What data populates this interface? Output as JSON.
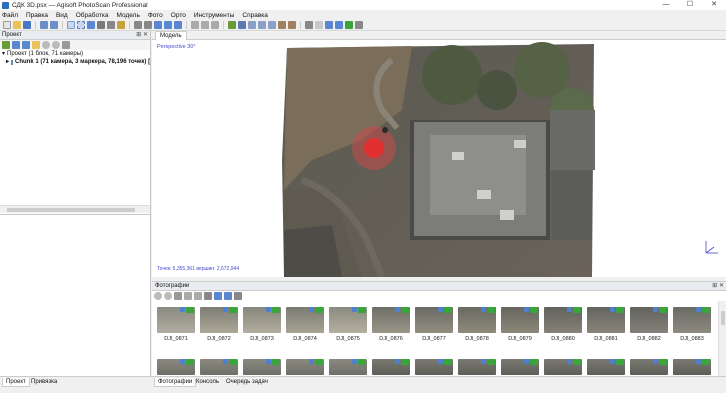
{
  "window": {
    "title": "СДК 3D.psx — Agisoft PhotoScan Professional",
    "controls": [
      "—",
      "☐",
      "✕"
    ]
  },
  "menu": [
    "Файл",
    "Правка",
    "Вид",
    "Обработка",
    "Модель",
    "Фото",
    "Орто",
    "Инструменты",
    "Справка"
  ],
  "project_panel": {
    "title": "Проект",
    "tree": {
      "root": "Проект (1 блок, 71 камеры)",
      "chunk": "Chunk 1 (71 камера, 3 маркера, 78,196 точек) ["
    }
  },
  "left_tabs": [
    "Проект",
    "Привязка"
  ],
  "model_tab": "Модель",
  "viewport": {
    "projection": "Perspective 30°",
    "status": "Точек: 5,355,361 вершин: 2,672,944"
  },
  "photos_panel": {
    "title": "Фотографии",
    "captions": [
      "DJI_0871",
      "DJI_0872",
      "DJI_0873",
      "DJI_0874",
      "DJI_0875",
      "DJI_0876",
      "DJI_0877",
      "DJI_0878",
      "DJI_0879",
      "DJI_0880",
      "DJI_0881",
      "DJI_0882",
      "DJI_0883"
    ]
  },
  "bottom_tabs": [
    "Фотографии",
    "Консоль",
    "Очередь задач"
  ],
  "colors": {
    "accent": "#2b6fb7",
    "check": "#3aa53a",
    "marker": "#d42a2a",
    "viewport_text": "#4a4acc"
  }
}
